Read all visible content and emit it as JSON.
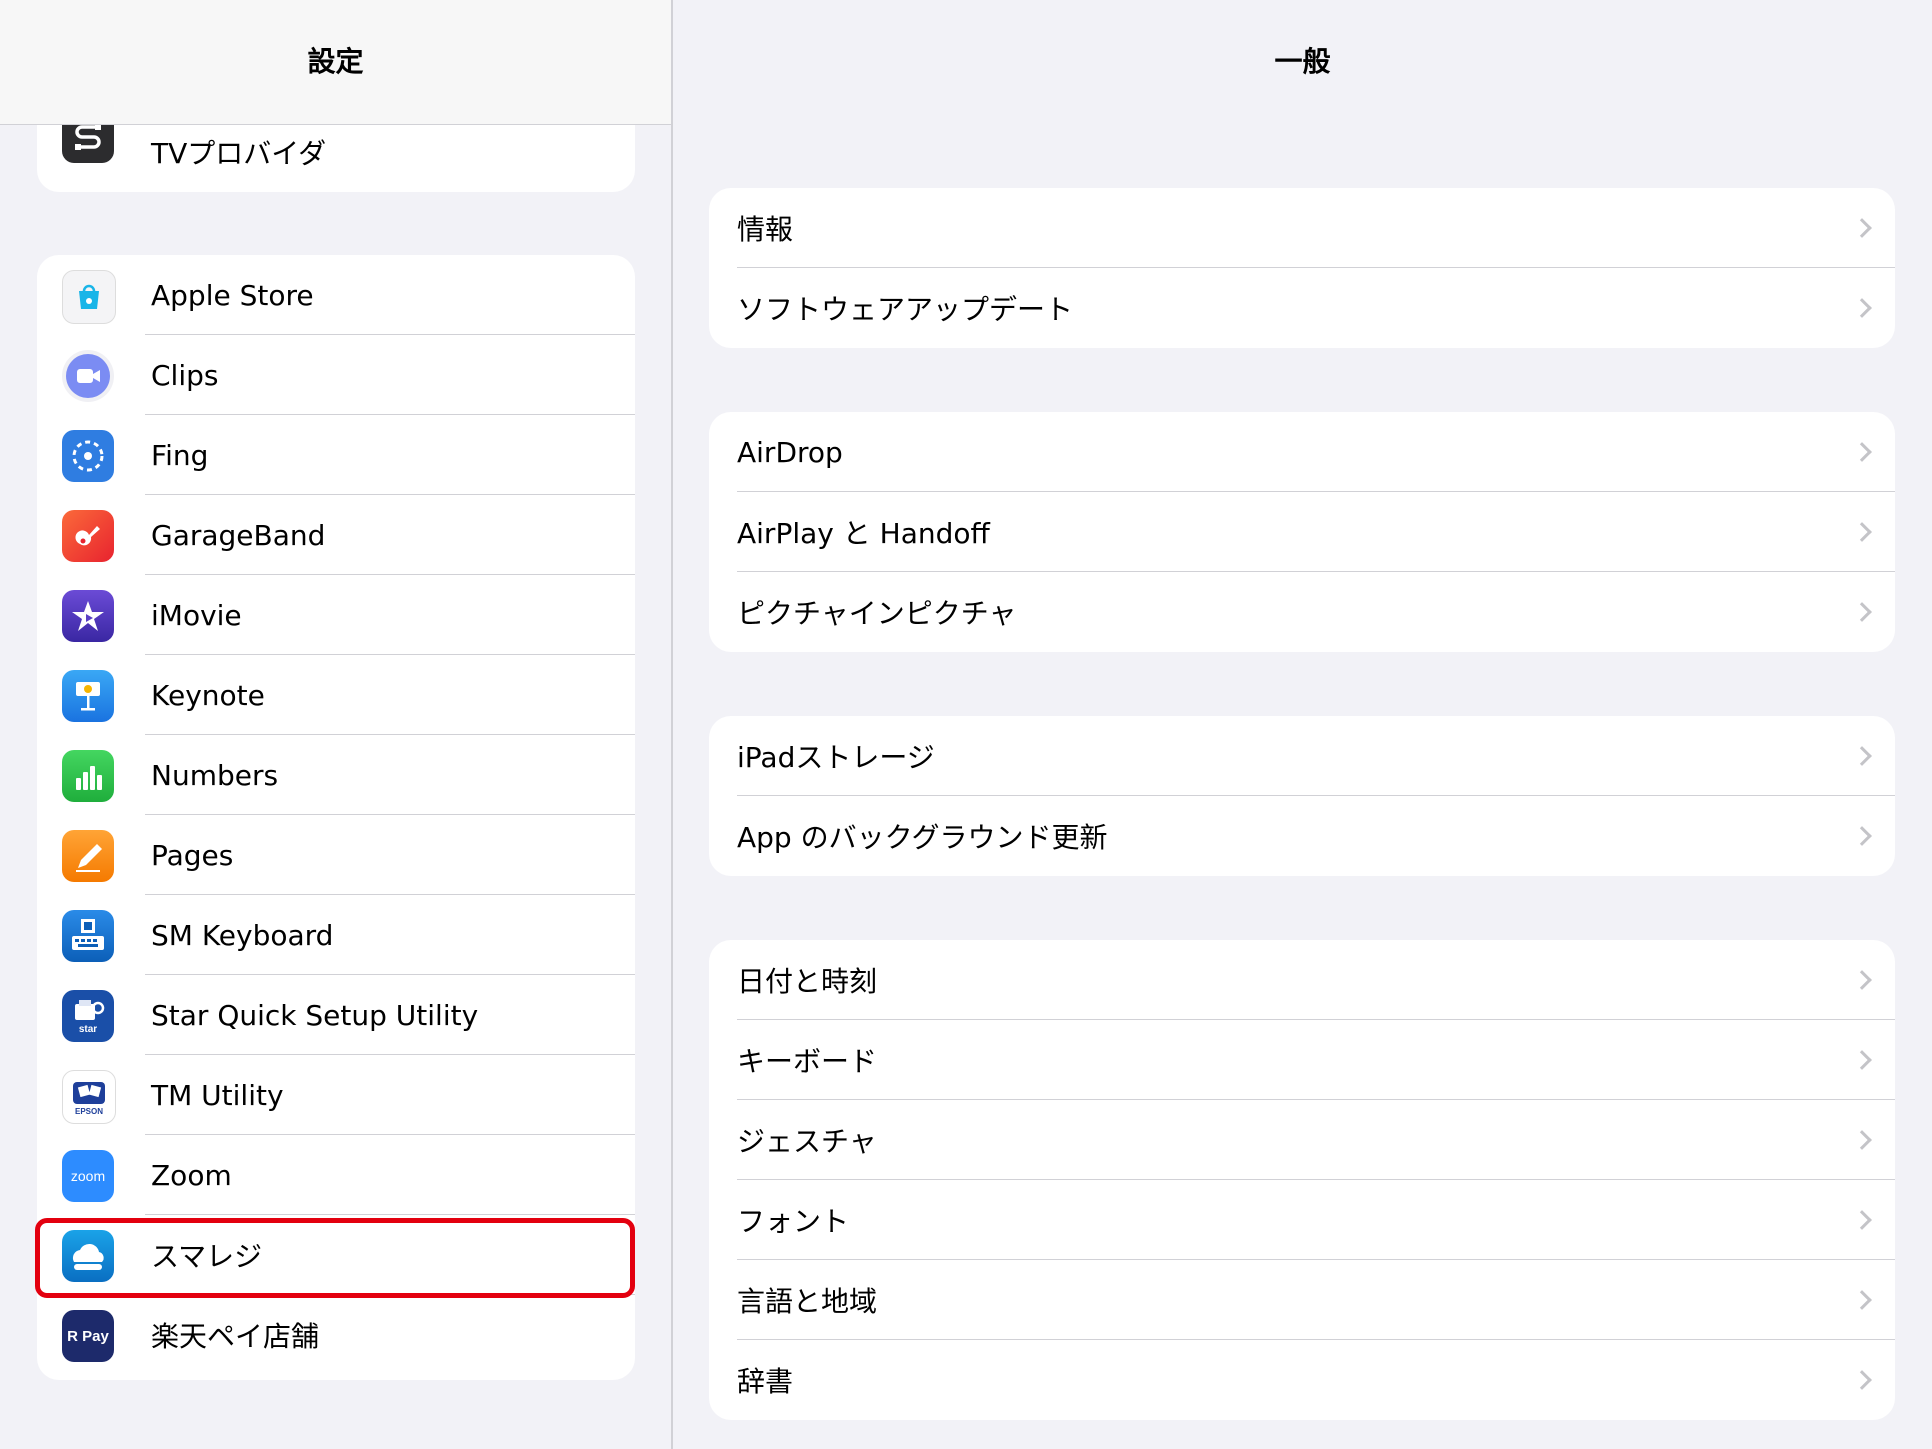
{
  "sidebar": {
    "title": "設定",
    "top_item": {
      "label": "TVプロバイダ",
      "icon": "tv-provider-icon"
    },
    "apps": [
      {
        "label": "Apple Store",
        "icon": "apple-store-icon"
      },
      {
        "label": "Clips",
        "icon": "clips-icon"
      },
      {
        "label": "Fing",
        "icon": "fing-icon"
      },
      {
        "label": "GarageBand",
        "icon": "garageband-icon"
      },
      {
        "label": "iMovie",
        "icon": "imovie-icon"
      },
      {
        "label": "Keynote",
        "icon": "keynote-icon"
      },
      {
        "label": "Numbers",
        "icon": "numbers-icon"
      },
      {
        "label": "Pages",
        "icon": "pages-icon"
      },
      {
        "label": "SM Keyboard",
        "icon": "sm-keyboard-icon"
      },
      {
        "label": "Star Quick Setup Utility",
        "icon": "star-quick-setup-icon"
      },
      {
        "label": "TM Utility",
        "icon": "tm-utility-icon",
        "icon_text": "EPSON"
      },
      {
        "label": "Zoom",
        "icon": "zoom-icon",
        "icon_text": "zoom"
      },
      {
        "label": "スマレジ",
        "icon": "smaregi-icon",
        "highlighted": true
      },
      {
        "label": "楽天ペイ店舗",
        "icon": "rakuten-pay-icon",
        "icon_text": "R Pay"
      }
    ]
  },
  "detail": {
    "title": "一般",
    "groups": [
      {
        "items": [
          "情報",
          "ソフトウェアアップデート"
        ]
      },
      {
        "items": [
          "AirDrop",
          "AirPlay と Handoff",
          "ピクチャインピクチャ"
        ]
      },
      {
        "items": [
          "iPadストレージ",
          "App のバックグラウンド更新"
        ]
      },
      {
        "items": [
          "日付と時刻",
          "キーボード",
          "ジェスチャ",
          "フォント",
          "言語と地域",
          "辞書"
        ]
      }
    ]
  },
  "colors": {
    "background": "#f2f2f7",
    "card": "#ffffff",
    "separator": "#d1d1d6",
    "highlight": "#e3000f",
    "chevron": "#c4c4c8"
  }
}
